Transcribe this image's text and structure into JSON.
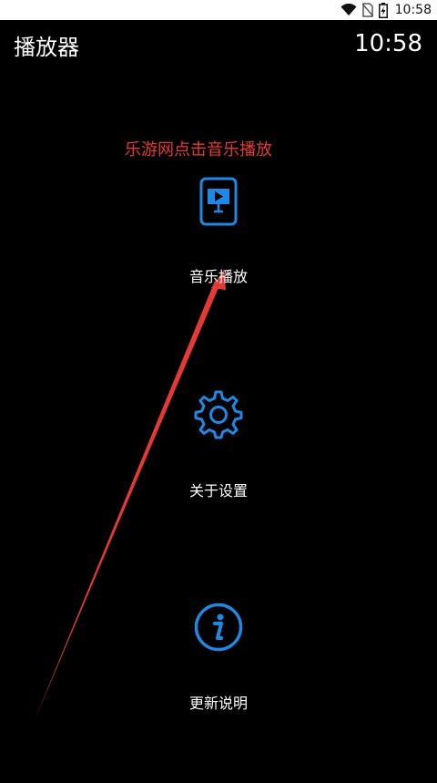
{
  "status_bar": {
    "time": "10:58",
    "icons": [
      "wifi-icon",
      "no-sim-icon",
      "battery-charging-icon"
    ]
  },
  "header": {
    "title": "播放器",
    "clock": "10:58"
  },
  "annotation": {
    "hint": "乐游网点击音乐播放",
    "color": "#e53935"
  },
  "menu": {
    "items": [
      {
        "label": "音乐播放",
        "icon": "music-player-icon"
      },
      {
        "label": "关于设置",
        "icon": "gear-icon"
      },
      {
        "label": "更新说明",
        "icon": "info-icon"
      }
    ]
  },
  "colors": {
    "background": "#000000",
    "accent": "#1e88e5",
    "status_bar": "#ffffff"
  }
}
